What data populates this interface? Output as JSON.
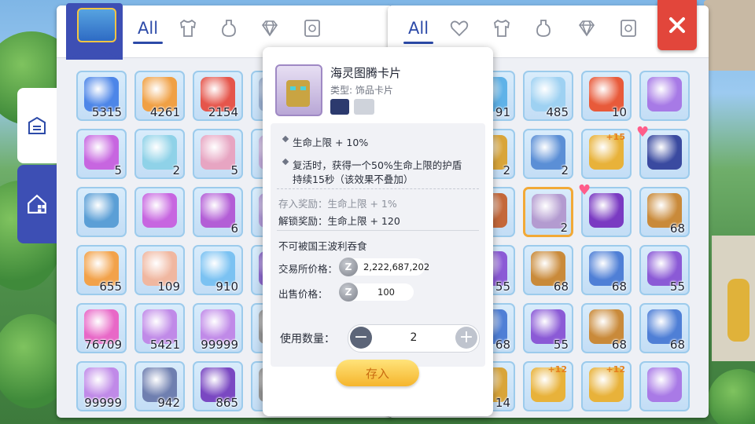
{
  "left_panel": {
    "tabs": [
      {
        "label": "All",
        "icon": "all-tab",
        "active": true
      },
      {
        "label": "",
        "icon": "armor-shirt-icon"
      },
      {
        "label": "",
        "icon": "potion-bottle-icon"
      },
      {
        "label": "",
        "icon": "gem-icon"
      },
      {
        "label": "",
        "icon": "card-icon"
      }
    ],
    "items": [
      {
        "icon": "blue-ticket-icon",
        "count": "5315",
        "color": "#4d86e8"
      },
      {
        "icon": "orange-ticket-icon",
        "count": "4261",
        "color": "#f0a044"
      },
      {
        "icon": "red-ticket-icon",
        "count": "2154",
        "color": "#e5554b"
      },
      {
        "icon": "partial-item-icon",
        "count": "",
        "color": "#9db4d6"
      },
      {
        "icon": "pink-card-icon",
        "count": "5",
        "color": "#c766e0"
      },
      {
        "icon": "crystal-box-icon",
        "count": "2",
        "color": "#8fd2e8"
      },
      {
        "icon": "character-card-icon",
        "count": "5",
        "color": "#e7a5c2"
      },
      {
        "icon": "partial-item-icon",
        "count": "",
        "color": "#c7b0e0"
      },
      {
        "icon": "landscape-card-icon",
        "count": "",
        "color": "#5b9fd6"
      },
      {
        "icon": "pink-card-icon",
        "count": "",
        "color": "#c766e0"
      },
      {
        "icon": "pink-card-icon",
        "count": "6",
        "color": "#b35ed6"
      },
      {
        "icon": "partial-item-icon",
        "count": "",
        "color": "#b59ddd"
      },
      {
        "icon": "orange-crystal-icon",
        "count": "655",
        "color": "#f2a24a"
      },
      {
        "icon": "powder-pile-icon",
        "count": "109",
        "color": "#f0b7a0"
      },
      {
        "icon": "blue-orb-icon",
        "count": "910",
        "color": "#7bc2f2"
      },
      {
        "icon": "partial-item-icon",
        "count": "",
        "color": "#8f6ad1"
      },
      {
        "icon": "pink-glow-icon",
        "count": "76709",
        "color": "#e868c7"
      },
      {
        "icon": "purple-card-icon",
        "count": "5421",
        "color": "#c08ae8"
      },
      {
        "icon": "purple-card-icon",
        "count": "99999",
        "color": "#c08ae8"
      },
      {
        "icon": "partial-item-icon",
        "count": "",
        "color": "#9a9a9a"
      },
      {
        "icon": "purple-card-icon",
        "count": "99999",
        "color": "#c08ae8"
      },
      {
        "icon": "dark-stone-icon",
        "count": "942",
        "color": "#6f7fb0"
      },
      {
        "icon": "purple-crystal-icon",
        "count": "865",
        "color": "#7a48c2"
      },
      {
        "icon": "partial-item-icon",
        "count": "",
        "color": "#9a9a9a"
      }
    ],
    "side_tabs": [
      {
        "icon": "storage-list-icon"
      },
      {
        "icon": "house-grid-icon"
      }
    ]
  },
  "right_panel": {
    "tabs": [
      {
        "label": "All",
        "icon": "all-tab",
        "active": true
      },
      {
        "label": "",
        "icon": "heart-outline-icon"
      },
      {
        "label": "",
        "icon": "armor-shirt-icon"
      },
      {
        "label": "",
        "icon": "potion-bottle-icon"
      },
      {
        "label": "",
        "icon": "gem-icon"
      },
      {
        "label": "",
        "icon": "card-icon"
      }
    ],
    "items": [
      {
        "icon": "partial-crystal-icon",
        "count": "91",
        "color": "#5fb2e8"
      },
      {
        "icon": "ice-crystal-icon",
        "count": "485",
        "color": "#9ed1f2"
      },
      {
        "icon": "red-feather-icon",
        "count": "10",
        "color": "#e85a3a"
      },
      {
        "icon": "purple-gift-box-icon",
        "count": "",
        "color": "#a77ae6"
      },
      {
        "icon": "gold-card-icon",
        "count": "2",
        "color": "#d9a53a"
      },
      {
        "icon": "blue-card-icon",
        "count": "2",
        "color": "#5b8fd6"
      },
      {
        "icon": "gold-ring-icon",
        "count": "",
        "plus": "+15",
        "color": "#e8b23a"
      },
      {
        "icon": "character-avatar-icon",
        "count": "",
        "color": "#3a4aa0",
        "heart": true
      },
      {
        "icon": "mushroom-monster-icon",
        "count": "",
        "color": "#c4683a"
      },
      {
        "icon": "totem-card-icon",
        "count": "2",
        "color": "#b39bd0",
        "selected": true
      },
      {
        "icon": "dragon-card-icon",
        "count": "",
        "color": "#7a3ac2",
        "heart": true
      },
      {
        "icon": "treasure-chest-gold-icon",
        "count": "68",
        "color": "#c98a3a"
      },
      {
        "icon": "treasure-chest-purple-icon",
        "count": "55",
        "color": "#8b5ad6"
      },
      {
        "icon": "treasure-chest-gold-icon",
        "count": "68",
        "color": "#c98a3a"
      },
      {
        "icon": "treasure-chest-blue-icon",
        "count": "68",
        "color": "#4f7fd6"
      },
      {
        "icon": "treasure-chest-purple-icon",
        "count": "55",
        "color": "#8b5ad6"
      },
      {
        "icon": "treasure-chest-blue-icon",
        "count": "68",
        "color": "#4f7fd6"
      },
      {
        "icon": "treasure-chest-purple-icon",
        "count": "55",
        "color": "#8b5ad6"
      },
      {
        "icon": "treasure-chest-gold-icon",
        "count": "68",
        "color": "#c98a3a"
      },
      {
        "icon": "treasure-chest-blue-icon",
        "count": "68",
        "color": "#4f7fd6"
      },
      {
        "icon": "partial-item-icon",
        "count": "14",
        "color": "#d9a53a"
      },
      {
        "icon": "gold-shoe-icon",
        "count": "",
        "plus": "+12",
        "color": "#e8b23a"
      },
      {
        "icon": "gold-shield-icon",
        "count": "",
        "plus": "+12",
        "color": "#e8b23a"
      },
      {
        "icon": "purple-swirl-icon",
        "count": "",
        "color": "#a97ae6"
      }
    ],
    "close_icon": "close-icon"
  },
  "tooltip": {
    "name": "海灵图腾卡片",
    "type_line": "类型: 饰品卡片",
    "effects": [
      "生命上限 + 10%",
      "复活时，获得一个50%生命上限的护盾",
      "持续15秒（该效果不叠加）"
    ],
    "store_reward": "存入奖励：生命上限 + 1%",
    "unlock_reward": "解锁奖励：生命上限 + 120",
    "untradeable_note": "不可被国王波利吞食",
    "exchange_price_label": "交易所价格：",
    "exchange_price": "2,222,687,202",
    "sell_price_label": "出售价格：",
    "sell_price": "100",
    "zeny_symbol": "Z",
    "quantity_label": "使用数量：",
    "quantity_value": "2",
    "deposit_button": "存入"
  }
}
